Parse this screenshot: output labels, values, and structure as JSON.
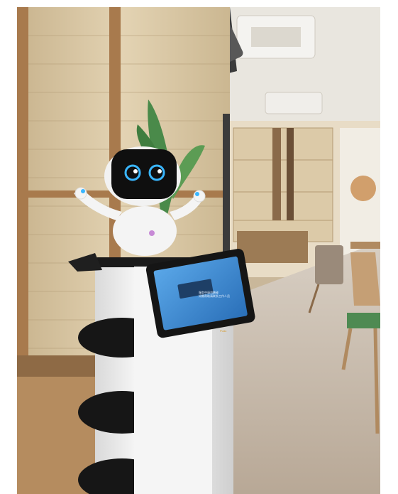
{
  "photo": {
    "subject": "service-robot",
    "screen": {
      "line1": "服务中请勿触碰",
      "line2": "如需帮助请联系工作人员"
    },
    "brand": "Pudu",
    "colors": {
      "robot_body": "#f3f3f3",
      "robot_tray": "#1a1a1a",
      "screen_blue": "#3f8ed6",
      "robot_eyes": "#39b6ff",
      "bamboo_wall": "#d8c6a4",
      "floor": "#c9bcae"
    }
  }
}
